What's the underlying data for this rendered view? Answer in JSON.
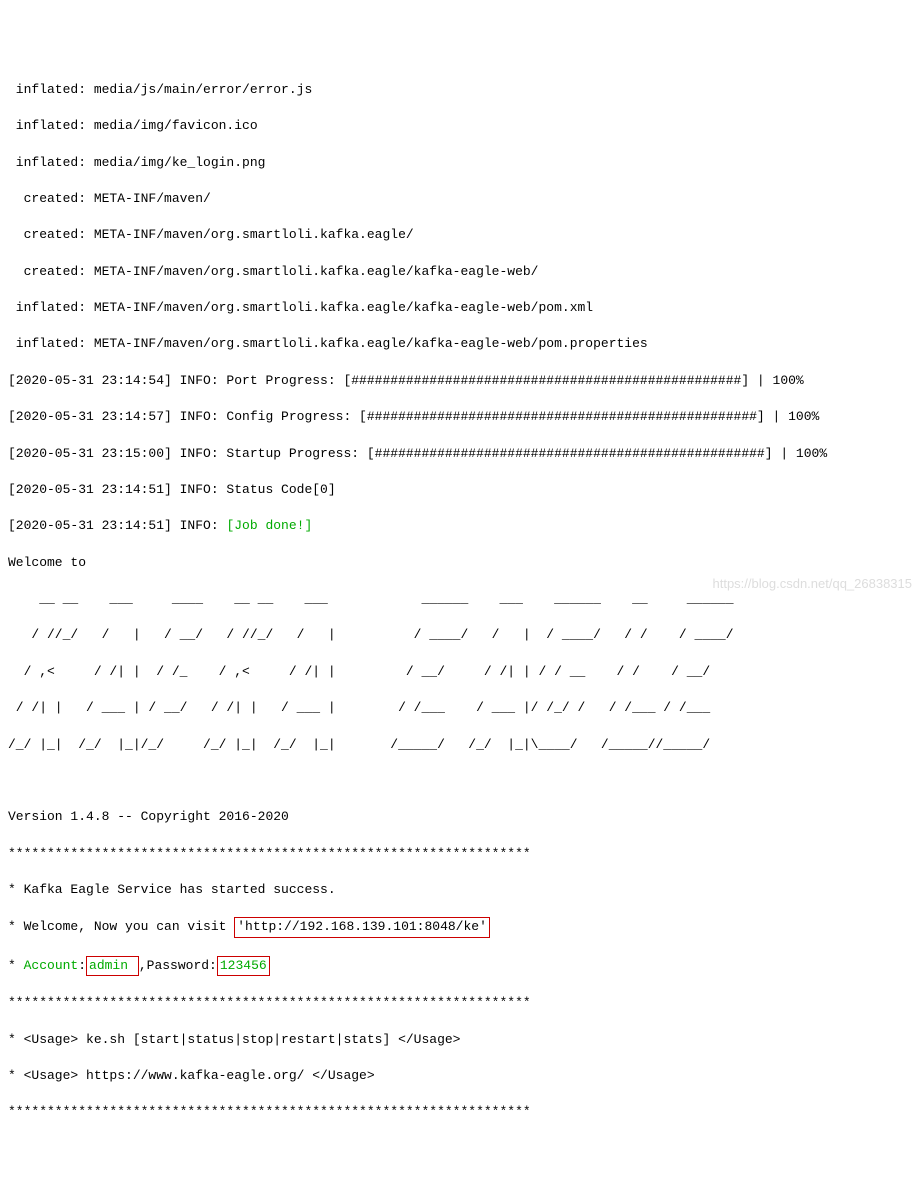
{
  "lines": {
    "l1": " inflated: media/js/main/error/error.js",
    "l2": " inflated: media/img/favicon.ico",
    "l3": " inflated: media/img/ke_login.png",
    "l4": "  created: META-INF/maven/",
    "l5": "  created: META-INF/maven/org.smartloli.kafka.eagle/",
    "l6": "  created: META-INF/maven/org.smartloli.kafka.eagle/kafka-eagle-web/",
    "l7": " inflated: META-INF/maven/org.smartloli.kafka.eagle/kafka-eagle-web/pom.xml",
    "l8": " inflated: META-INF/maven/org.smartloli.kafka.eagle/kafka-eagle-web/pom.properties",
    "l9": "[2020-05-31 23:14:54] INFO: Port Progress: [##################################################] | 100%",
    "l10": "[2020-05-31 23:14:57] INFO: Config Progress: [##################################################] | 100%",
    "l11": "[2020-05-31 23:15:00] INFO: Startup Progress: [##################################################] | 100%",
    "l12": "[2020-05-31 23:14:51] INFO: Status Code[0]",
    "l13a": "[2020-05-31 23:14:51] INFO: ",
    "l13b": "[Job done!]",
    "welcome": "Welcome to",
    "ascii1": "    __ __    ___     ____    __ __    ___            ______    ___    ______    __     ______",
    "ascii2": "   / //_/   /   |   / __/   / //_/   /   |          / ____/   /   |  / ____/   / /    / ____/",
    "ascii3": "  / ,<     / /| |  / /_    / ,<     / /| |         / __/     / /| | / / __    / /    / __/",
    "ascii4": " / /| |   / ___ | / __/   / /| |   / ___ |        / /___    / ___ |/ /_/ /   / /___ / /___",
    "ascii5": "/_/ |_|  /_/  |_|/_/     /_/ |_|  /_/  |_|       /_____/   /_/  |_|\\____/   /_____//_____/",
    "blank": "",
    "version": "Version 1.4.8 -- Copyright 2016-2020",
    "stars": "*******************************************************************",
    "started": "* Kafka Eagle Service has started success.",
    "visit_a": "* Welcome, Now you can visit ",
    "visit_b": "'http://192.168.139.101:8048/ke'",
    "acct_a": "* ",
    "acct_b": "Account",
    "acct_c": ":",
    "acct_d": "admin ",
    "acct_e": ",Password:",
    "acct_f": "123456",
    "usage1": "* <Usage> ke.sh [start|status|stop|restart|stats] </Usage>",
    "usage2": "* <Usage> https://www.kafka-eagle.org/ </Usage>"
  },
  "watermark": "https://blog.csdn.net/qq_26838315"
}
